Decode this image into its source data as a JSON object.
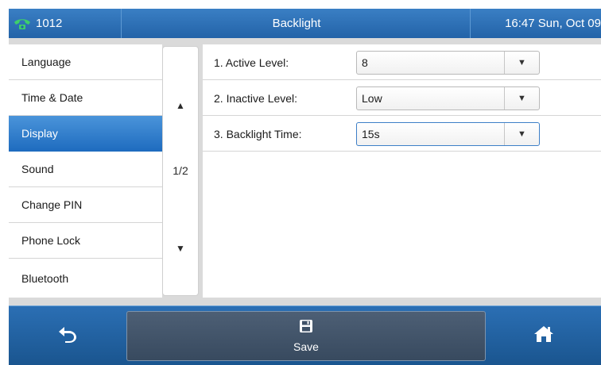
{
  "titlebar": {
    "account": "1012",
    "title": "Backlight",
    "datetime": "16:47 Sun, Oct 09",
    "account_icon": "phone-handset-icon"
  },
  "menu": {
    "items": [
      {
        "label": "Language",
        "active": false
      },
      {
        "label": "Time & Date",
        "active": false
      },
      {
        "label": "Display",
        "active": true
      },
      {
        "label": "Sound",
        "active": false
      },
      {
        "label": "Change PIN",
        "active": false
      },
      {
        "label": "Phone Lock",
        "active": false
      },
      {
        "label": "Bluetooth",
        "active": false
      }
    ]
  },
  "scroller": {
    "page": "1/2",
    "up_icon": "triangle-up-icon",
    "down_icon": "triangle-down-icon"
  },
  "settings": {
    "rows": [
      {
        "label": "1. Active Level:",
        "value": "8"
      },
      {
        "label": "2. Inactive Level:",
        "value": "Low"
      },
      {
        "label": "3. Backlight Time:",
        "value": "15s"
      }
    ]
  },
  "softkeys": {
    "back_icon": "back-arrow-icon",
    "save_label": "Save",
    "save_icon": "floppy-disk-icon",
    "home_icon": "home-icon"
  },
  "colors": {
    "accent": "#1f6cbf",
    "titlebar": "#2363a8",
    "handset": "#3ecf6a"
  }
}
